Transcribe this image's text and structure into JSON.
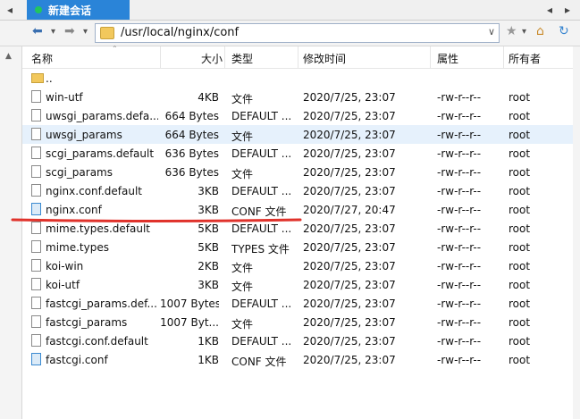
{
  "tab": {
    "label": "新建会话"
  },
  "address": {
    "path": "/usr/local/nginx/conf"
  },
  "columns": {
    "name": "名称",
    "size": "大小",
    "type": "类型",
    "modified": "修改时间",
    "attr": "属性",
    "owner": "所有者"
  },
  "files": [
    {
      "name": "..",
      "size": "",
      "type": "",
      "modified": "",
      "attr": "",
      "owner": "",
      "icon": "folder-icon"
    },
    {
      "name": "win-utf",
      "size": "4KB",
      "type": "文件",
      "modified": "2020/7/25, 23:07",
      "attr": "-rw-r--r--",
      "owner": "root",
      "icon": "file-icon"
    },
    {
      "name": "uwsgi_params.defa...",
      "size": "664 Bytes",
      "type": "DEFAULT ...",
      "modified": "2020/7/25, 23:07",
      "attr": "-rw-r--r--",
      "owner": "root",
      "icon": "file-icon"
    },
    {
      "name": "uwsgi_params",
      "size": "664 Bytes",
      "type": "文件",
      "modified": "2020/7/25, 23:07",
      "attr": "-rw-r--r--",
      "owner": "root",
      "icon": "file-icon"
    },
    {
      "name": "scgi_params.default",
      "size": "636 Bytes",
      "type": "DEFAULT ...",
      "modified": "2020/7/25, 23:07",
      "attr": "-rw-r--r--",
      "owner": "root",
      "icon": "file-icon"
    },
    {
      "name": "scgi_params",
      "size": "636 Bytes",
      "type": "文件",
      "modified": "2020/7/25, 23:07",
      "attr": "-rw-r--r--",
      "owner": "root",
      "icon": "file-icon"
    },
    {
      "name": "nginx.conf.default",
      "size": "3KB",
      "type": "DEFAULT ...",
      "modified": "2020/7/25, 23:07",
      "attr": "-rw-r--r--",
      "owner": "root",
      "icon": "file-icon"
    },
    {
      "name": "nginx.conf",
      "size": "3KB",
      "type": "CONF 文件",
      "modified": "2020/7/27, 20:47",
      "attr": "-rw-r--r--",
      "owner": "root",
      "icon": "conf-file-icon"
    },
    {
      "name": "mime.types.default",
      "size": "5KB",
      "type": "DEFAULT ...",
      "modified": "2020/7/25, 23:07",
      "attr": "-rw-r--r--",
      "owner": "root",
      "icon": "file-icon"
    },
    {
      "name": "mime.types",
      "size": "5KB",
      "type": "TYPES 文件",
      "modified": "2020/7/25, 23:07",
      "attr": "-rw-r--r--",
      "owner": "root",
      "icon": "file-icon"
    },
    {
      "name": "koi-win",
      "size": "2KB",
      "type": "文件",
      "modified": "2020/7/25, 23:07",
      "attr": "-rw-r--r--",
      "owner": "root",
      "icon": "file-icon"
    },
    {
      "name": "koi-utf",
      "size": "3KB",
      "type": "文件",
      "modified": "2020/7/25, 23:07",
      "attr": "-rw-r--r--",
      "owner": "root",
      "icon": "file-icon"
    },
    {
      "name": "fastcgi_params.def...",
      "size": "1007 Bytes",
      "type": "DEFAULT ...",
      "modified": "2020/7/25, 23:07",
      "attr": "-rw-r--r--",
      "owner": "root",
      "icon": "file-icon"
    },
    {
      "name": "fastcgi_params",
      "size": "1007 Byt...",
      "type": "文件",
      "modified": "2020/7/25, 23:07",
      "attr": "-rw-r--r--",
      "owner": "root",
      "icon": "file-icon"
    },
    {
      "name": "fastcgi.conf.default",
      "size": "1KB",
      "type": "DEFAULT ...",
      "modified": "2020/7/25, 23:07",
      "attr": "-rw-r--r--",
      "owner": "root",
      "icon": "file-icon"
    },
    {
      "name": "fastcgi.conf",
      "size": "1KB",
      "type": "CONF 文件",
      "modified": "2020/7/25, 23:07",
      "attr": "-rw-r--r--",
      "owner": "root",
      "icon": "conf-file-icon"
    }
  ],
  "colors": {
    "tab_bg": "#2a84d8",
    "selected_row": "#e6f1fc",
    "annotation": "#e0322b"
  }
}
